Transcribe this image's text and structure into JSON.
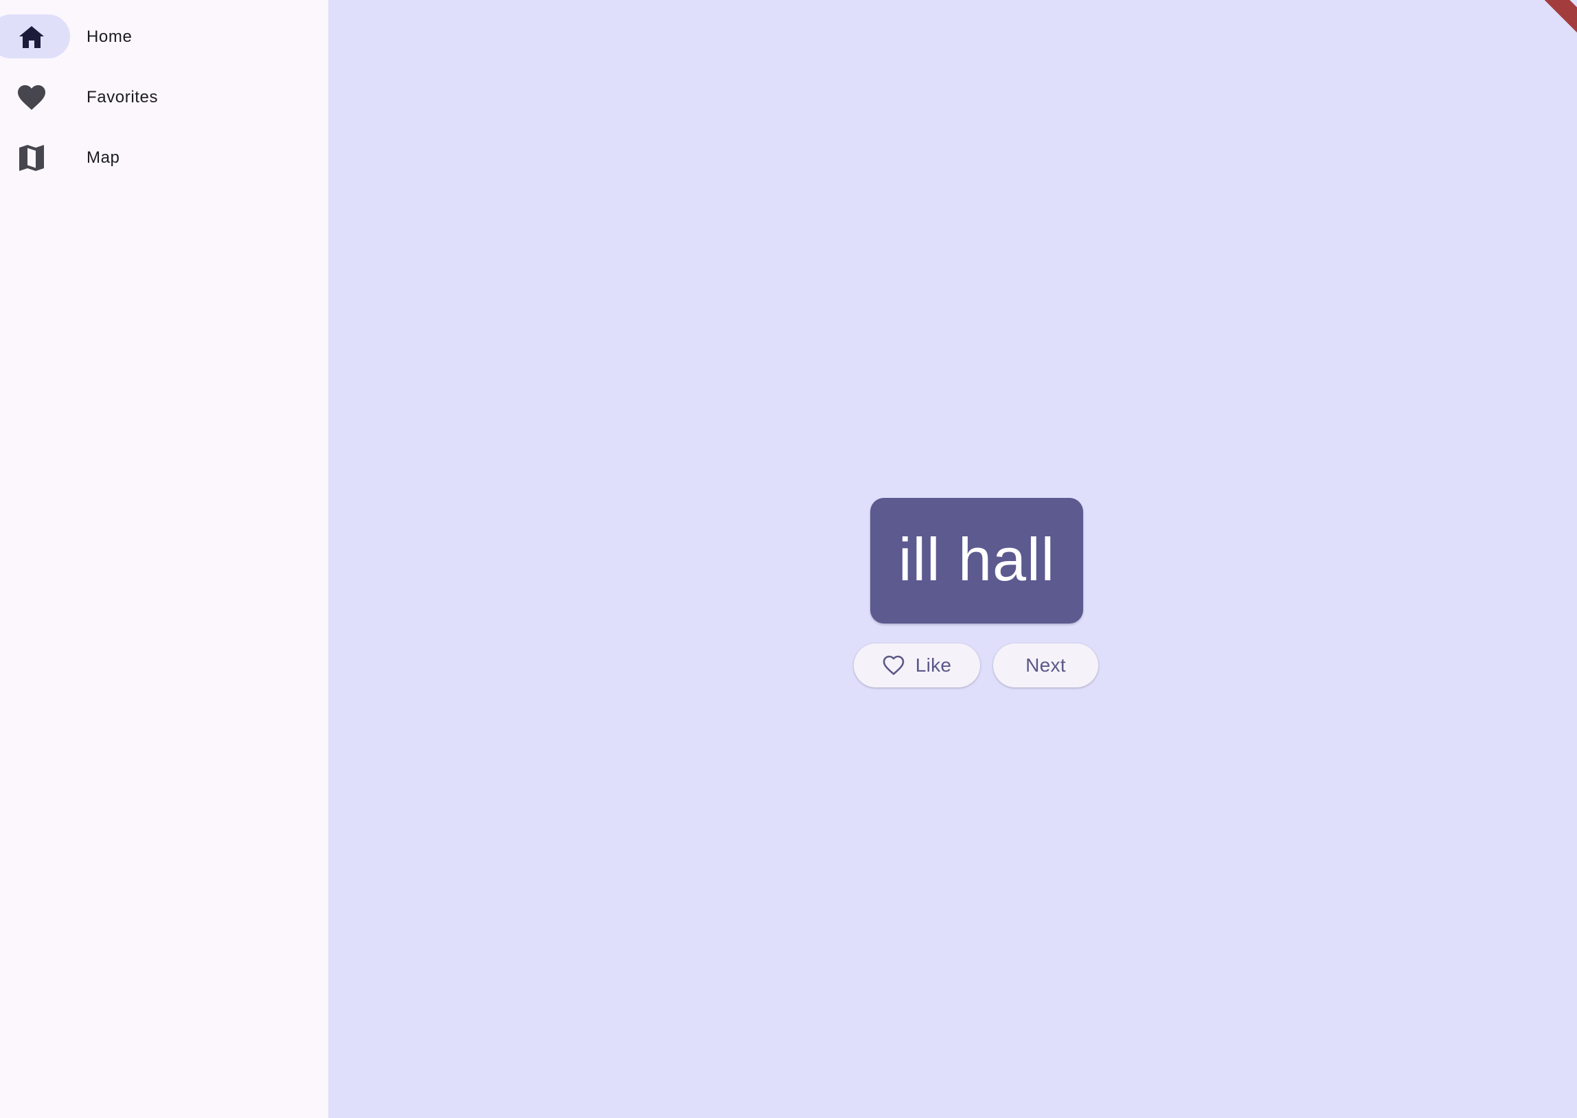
{
  "sidebar": {
    "items": [
      {
        "label": "Home",
        "icon": "home-icon",
        "selected": true
      },
      {
        "label": "Favorites",
        "icon": "heart-icon",
        "selected": false
      },
      {
        "label": "Map",
        "icon": "map-icon",
        "selected": false
      }
    ]
  },
  "main": {
    "word": "ill hall",
    "like_label": "Like",
    "next_label": "Next"
  },
  "colors": {
    "sidebar_bg": "#fbf7fd",
    "main_bg": "#dfdffc",
    "card_bg": "#5c5a8f",
    "selected_indicator": "#dfdff9",
    "button_bg": "#f6f2f9",
    "button_text": "#5a5888"
  }
}
